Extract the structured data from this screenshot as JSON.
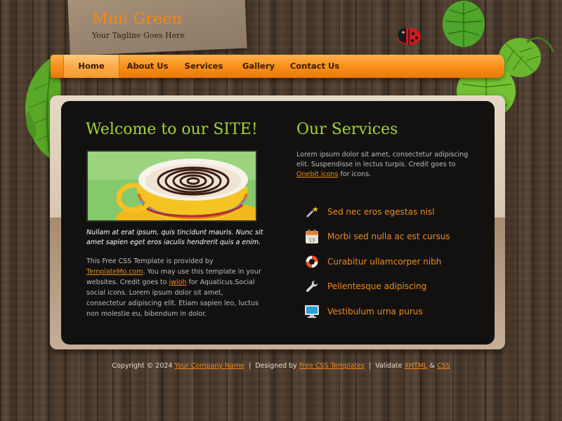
{
  "header": {
    "site_title": "Mini Green",
    "tagline": "Your Tagline Goes Here"
  },
  "nav": {
    "items": [
      {
        "label": "Home",
        "active": true
      },
      {
        "label": "About Us",
        "active": false
      },
      {
        "label": "Services",
        "active": false
      },
      {
        "label": "Gallery",
        "active": false
      },
      {
        "label": "Contact Us",
        "active": false
      }
    ]
  },
  "welcome": {
    "heading": "Welcome to our SITE!",
    "caption": "Nullam at erat ipsum, quis tincidunt mauris. Nunc sit amet sapien eget eros iaculis hendrerit quis a enim.",
    "body_part1": "This Free CSS Template is provided by ",
    "link1": "TemplateMo.com",
    "body_part2": ". You may use this template in your websites. Credit goes to ",
    "link2": "jwloh",
    "body_part3": " for Aquaticus.Social social icons. Lorem ipsum dolor sit amet, consectetur adipiscing elit. Etiam sapien leo, luctus non molestie eu, bibendum in dolor."
  },
  "services": {
    "heading": "Our Services",
    "intro_part1": "Lorem ipsum dolor sit amet, consectetur adipiscing elit. Suspendisse in lectus turpis. Credit goes to ",
    "intro_link": "Onebit icons",
    "intro_part2": " for icons.",
    "items": [
      {
        "label": "Sed nec eros egestas nisl",
        "icon": "magic-wand-icon"
      },
      {
        "label": "Morbi sed nulla ac est cursus",
        "icon": "calendar-icon",
        "calendar_day": "13"
      },
      {
        "label": "Curabitur ullamcorper nibh",
        "icon": "lifebuoy-icon"
      },
      {
        "label": "Pellentesque adipiscing",
        "icon": "wrench-icon"
      },
      {
        "label": "Vestibulum urna purus",
        "icon": "monitor-icon"
      }
    ]
  },
  "footer": {
    "copyright": "Copyright © 2024",
    "company_link": "Your Company Name",
    "designed_by": "Designed by",
    "designer_link": "Free CSS Templates",
    "validate": "Validate",
    "xhtml_link": "XHTML",
    "amp": "&",
    "css_link": "CSS",
    "pipe": "|"
  },
  "colors": {
    "accent_orange": "#f08a1c",
    "heading_green": "#a3d23a",
    "panel_dark": "#121110"
  }
}
